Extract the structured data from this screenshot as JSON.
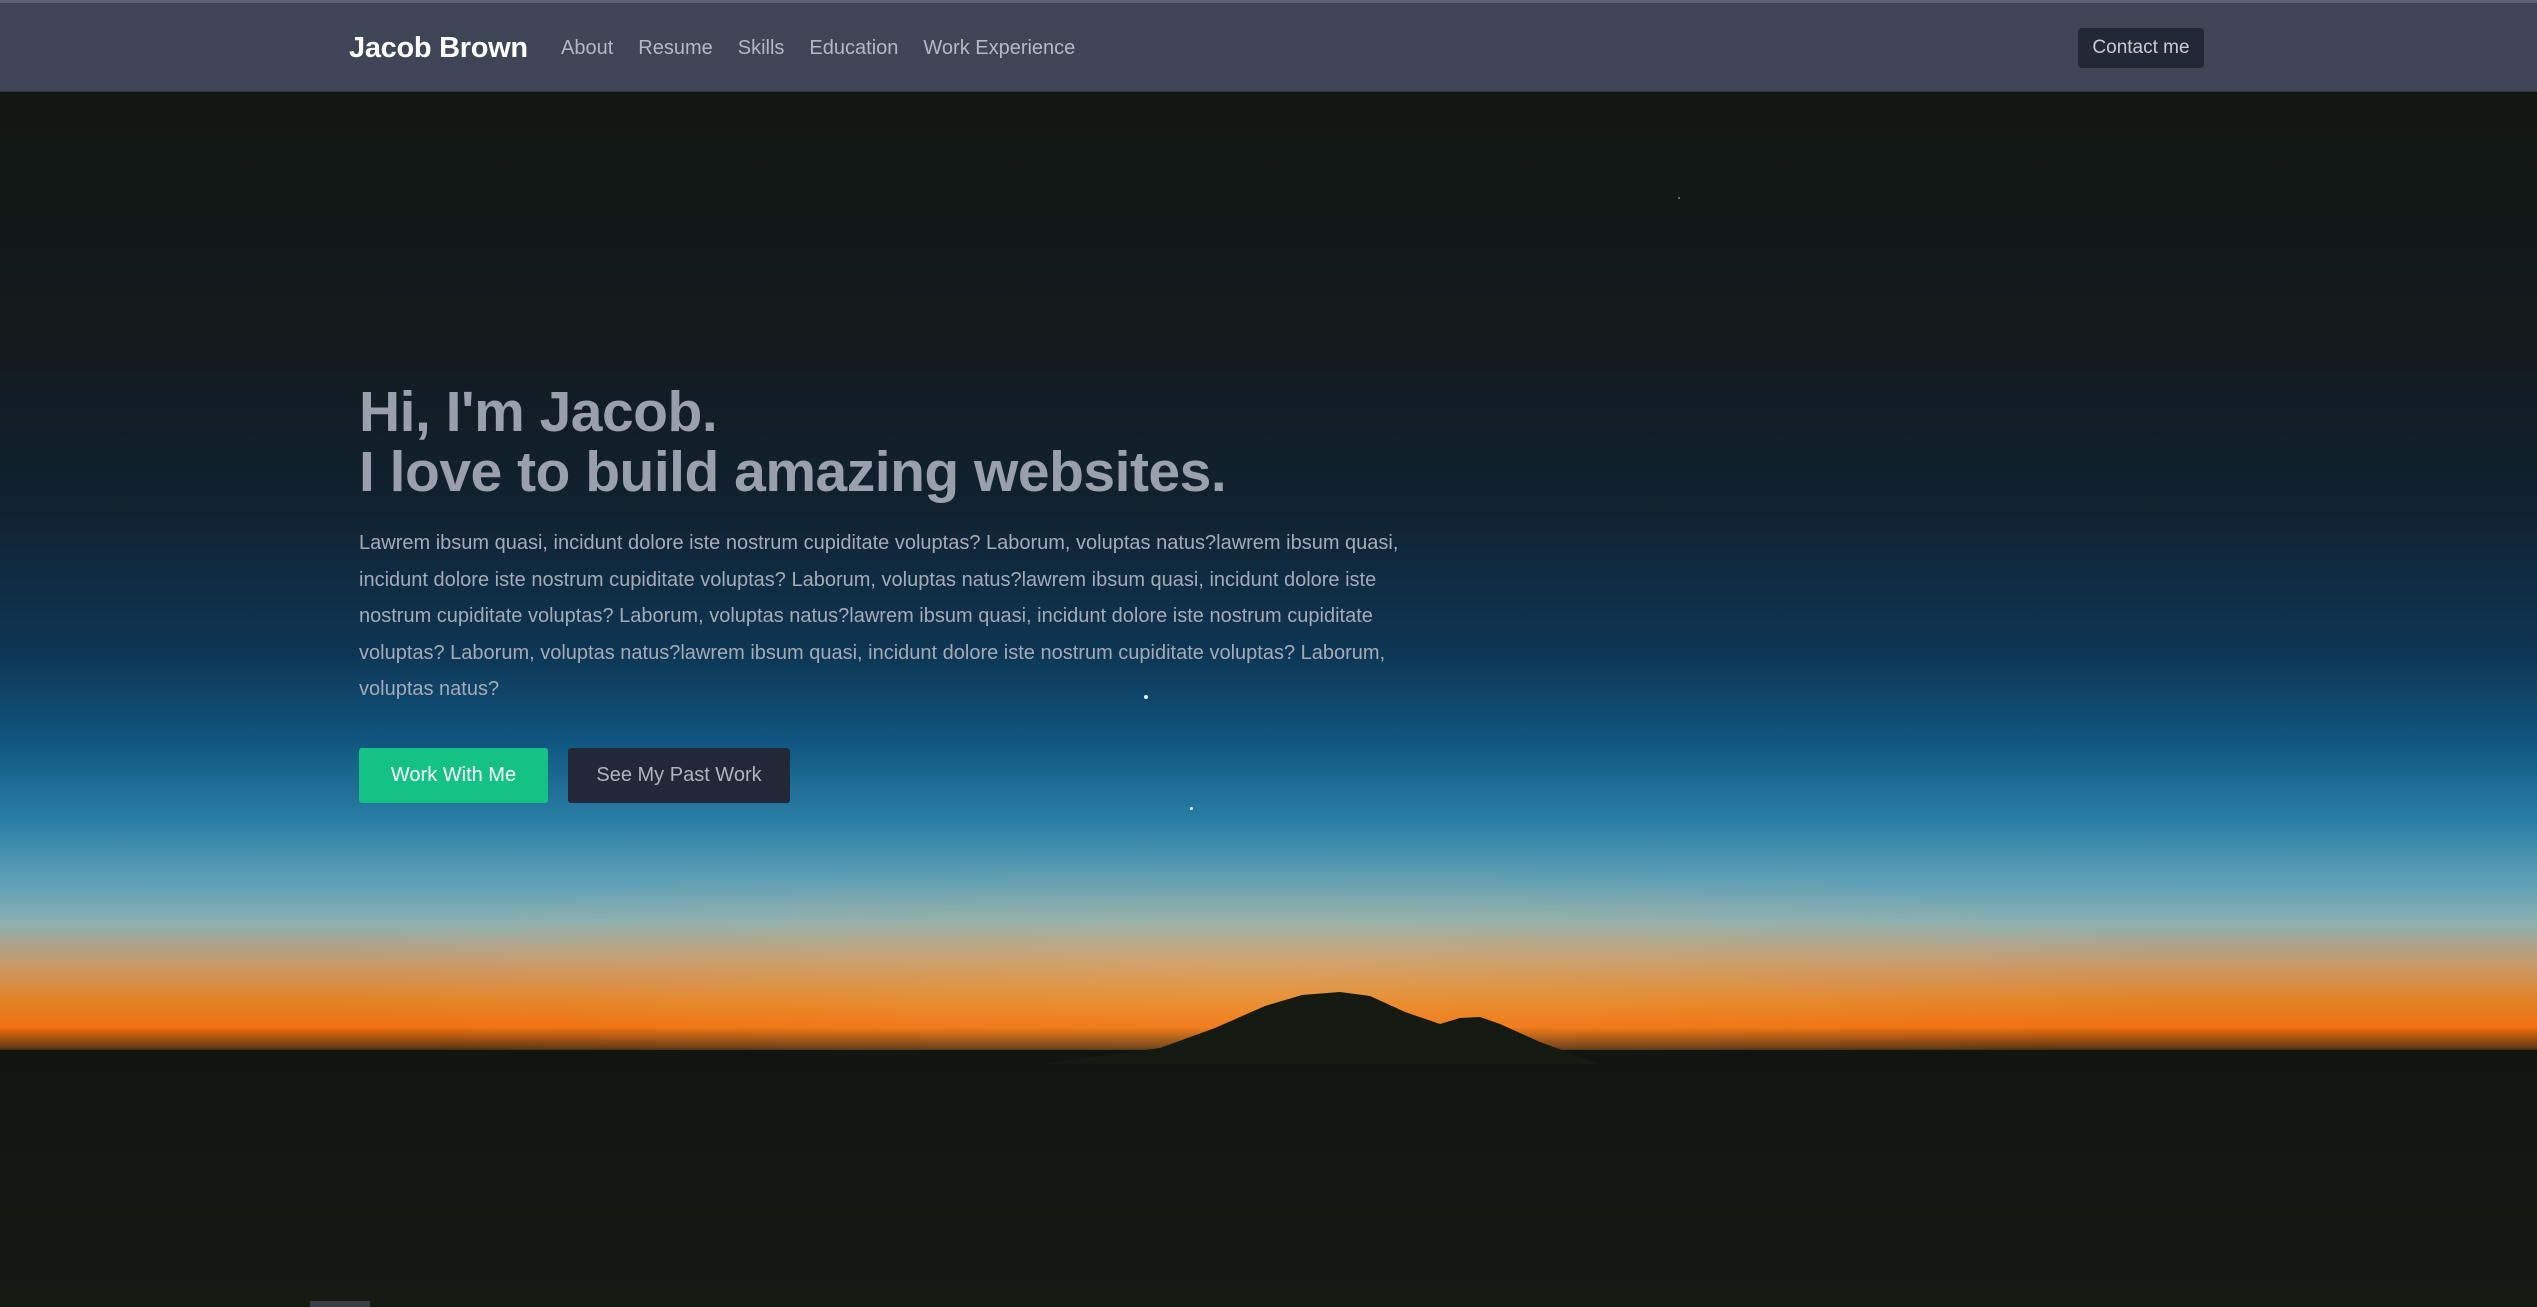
{
  "navbar": {
    "brand": "Jacob Brown",
    "links": [
      "About",
      "Resume",
      "Skills",
      "Education",
      "Work Experience"
    ],
    "contact_label": "Contact me"
  },
  "hero": {
    "title_line1": "Hi, I'm Jacob.",
    "title_line2": "I love to build amazing websites.",
    "description": "Lawrem ibsum quasi, incidunt dolore iste nostrum cupiditate voluptas? Laborum, voluptas natus?lawrem ibsum quasi, incidunt dolore iste nostrum cupiditate voluptas? Laborum, voluptas natus?lawrem ibsum quasi, incidunt dolore iste nostrum cupiditate voluptas? Laborum, voluptas natus?lawrem ibsum quasi, incidunt dolore iste nostrum cupiditate voluptas? Laborum, voluptas natus?lawrem ibsum quasi, incidunt dolore iste nostrum cupiditate voluptas? Laborum, voluptas natus?",
    "primary_button": "Work With Me",
    "secondary_button": "See My Past Work"
  },
  "colors": {
    "navbar_bg": "#3d4557",
    "accent": "#13c284",
    "secondary_button_bg": "#232838"
  }
}
